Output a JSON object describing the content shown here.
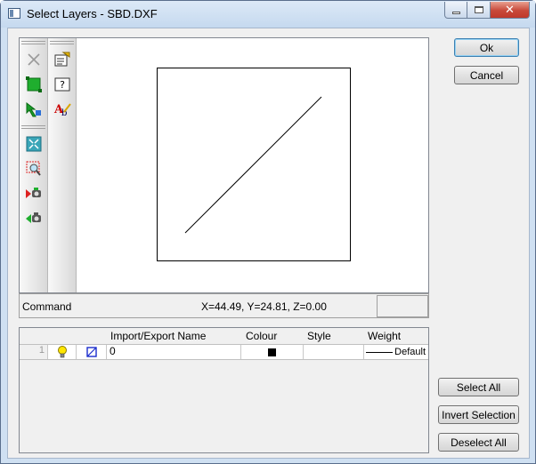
{
  "window": {
    "title": "Select Layers - SBD.DXF",
    "close_glyph": "✕"
  },
  "buttons": {
    "ok": "Ok",
    "cancel": "Cancel",
    "select_all": "Select All",
    "invert_selection": "Invert Selection",
    "deselect_all": "Deselect All"
  },
  "toolbar": {
    "left_tools": [
      "delete-icon",
      "select-green-icon",
      "select-arrow-icon",
      "zoom-extents-icon",
      "zoom-window-icon",
      "pan-forward-icon",
      "pan-back-icon"
    ],
    "right_tools": [
      "properties-icon",
      "help-icon",
      "text-style-icon"
    ]
  },
  "status": {
    "command_label": "Command",
    "coordinates": "X=44.49, Y=24.81, Z=0.00"
  },
  "layers_table": {
    "columns": [
      "Import/Export Name",
      "Colour",
      "Style",
      "Weight"
    ],
    "rows": [
      {
        "index": "1",
        "visible_icon": "lightbulb-icon",
        "freeze_icon": "layer-box-icon",
        "name": "0",
        "colour": "#000000",
        "style": "",
        "weight": "Default"
      }
    ]
  },
  "colors": {
    "accent": "#3c7fb1",
    "window_frame": "#cfe0f2",
    "close_button": "#c8493a"
  }
}
